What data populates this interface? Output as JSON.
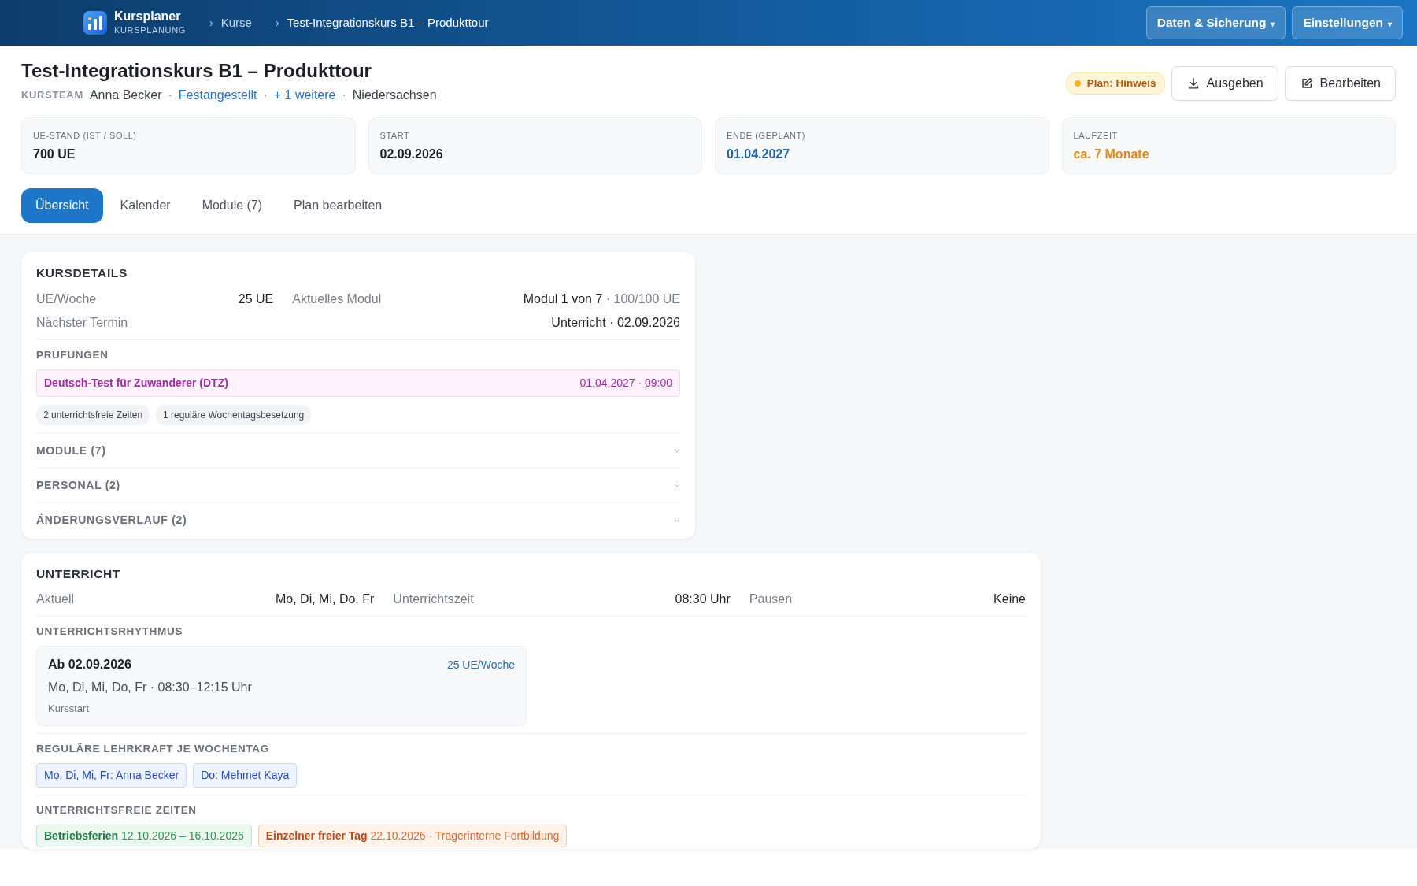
{
  "header": {
    "app_name": "Kursplaner",
    "app_subtitle": "KURSPLANUNG",
    "breadcrumb_separator": "›",
    "breadcrumbs": [
      {
        "label": "Kurse",
        "current": false
      },
      {
        "label": "Test-Integrationskurs B1 – Produkttour",
        "current": true
      }
    ],
    "menus": [
      {
        "label": "Daten & Sicherung",
        "caret": "▾"
      },
      {
        "label": "Einstellungen",
        "caret": "▾"
      }
    ]
  },
  "course": {
    "title": "Test-Integrationskurs B1 – Produkttour",
    "meta": [
      {
        "kind": "label",
        "text": "KURSTEAM"
      },
      {
        "kind": "text",
        "text": "Anna Becker"
      },
      {
        "kind": "sep",
        "text": "·"
      },
      {
        "kind": "link",
        "text": "Festangestellt"
      },
      {
        "kind": "sep",
        "text": "·"
      },
      {
        "kind": "link",
        "text": "+ 1 weitere"
      },
      {
        "kind": "sep",
        "text": "·"
      },
      {
        "kind": "text",
        "text": "Niedersachsen"
      }
    ]
  },
  "status_badge": {
    "label": "Plan: Hinweis"
  },
  "actions": [
    {
      "label": "Ausgeben",
      "kind": "download"
    },
    {
      "label": "Bearbeiten",
      "kind": "edit"
    }
  ],
  "stats": [
    {
      "label": "UE-STAND (IST / SOLL)",
      "value": "700 UE",
      "kind": "plain"
    },
    {
      "label": "START",
      "value": "02.09.2026",
      "kind": "plain"
    },
    {
      "label": "ENDE (GEPLANT)",
      "value": "01.04.2027",
      "kind": "info"
    },
    {
      "label": "LAUFZEIT",
      "value": "ca. 7 Monate",
      "kind": "warning"
    }
  ],
  "tabs": [
    {
      "label": "Übersicht",
      "selected": true
    },
    {
      "label": "Kalender",
      "selected": false
    },
    {
      "label": "Module (7)",
      "selected": false
    },
    {
      "label": "Plan bearbeiten",
      "selected": false
    }
  ],
  "details": {
    "title": "KURSDETAILS",
    "rows": [
      [
        {
          "label": "UE/Woche",
          "value": "25 UE"
        },
        {
          "label": "Aktuelles Modul",
          "value": "Modul 1 von 7",
          "extra": "· 100/100 UE"
        }
      ],
      [
        {
          "label": "Nächster Termin",
          "value": "Unterricht · 02.09.2026"
        }
      ]
    ],
    "exams_title": "PRÜFUNGEN",
    "exams": [
      {
        "name": "Deutsch-Test für Zuwanderer (DTZ)",
        "date": "01.04.2027 · 09:00"
      }
    ],
    "tags": [
      "2 unterrichtsfreie Zeiten",
      "1 reguläre Wochentagsbesetzung"
    ],
    "sections": [
      {
        "label": "MODULE (7)",
        "expanded": false
      },
      {
        "label": "PERSONAL (2)",
        "expanded": false
      },
      {
        "label": "ÄNDERUNGSVERLAUF (2)",
        "expanded": false
      }
    ]
  },
  "lessons": {
    "title": "UNTERRICHT",
    "rows": [
      [
        {
          "label": "Aktuell",
          "value": "Mo, Di, Mi, Do, Fr"
        },
        {
          "label": "Unterrichtszeit",
          "value": "08:30 Uhr"
        },
        {
          "label": "Pausen",
          "value": "Keine"
        }
      ]
    ],
    "rhythm_title": "UNTERRICHTSRHYTHMUS",
    "rhythm": [
      {
        "from": "Ab 02.09.2026",
        "rate": "25 UE/Woche",
        "schedule": "Mo, Di, Mi, Do, Fr · 08:30–12:15 Uhr",
        "note": "Kursstart"
      }
    ],
    "teachers_title": "REGULÄRE LEHRKRAFT JE WOCHENTAG",
    "teachers": [
      "Mo, Di, Mi, Fr: Anna Becker",
      "Do: Mehmet Kaya"
    ],
    "free_title": "UNTERRICHTSFREIE ZEITEN",
    "free": [
      {
        "kind": "holiday",
        "label": "Betriebsferien",
        "dates": "12.10.2026 – 16.10.2026"
      },
      {
        "kind": "day",
        "label": "Einzelner freier Tag",
        "dates": "22.10.2026 · Trägerinterne Fortbildung"
      }
    ]
  }
}
